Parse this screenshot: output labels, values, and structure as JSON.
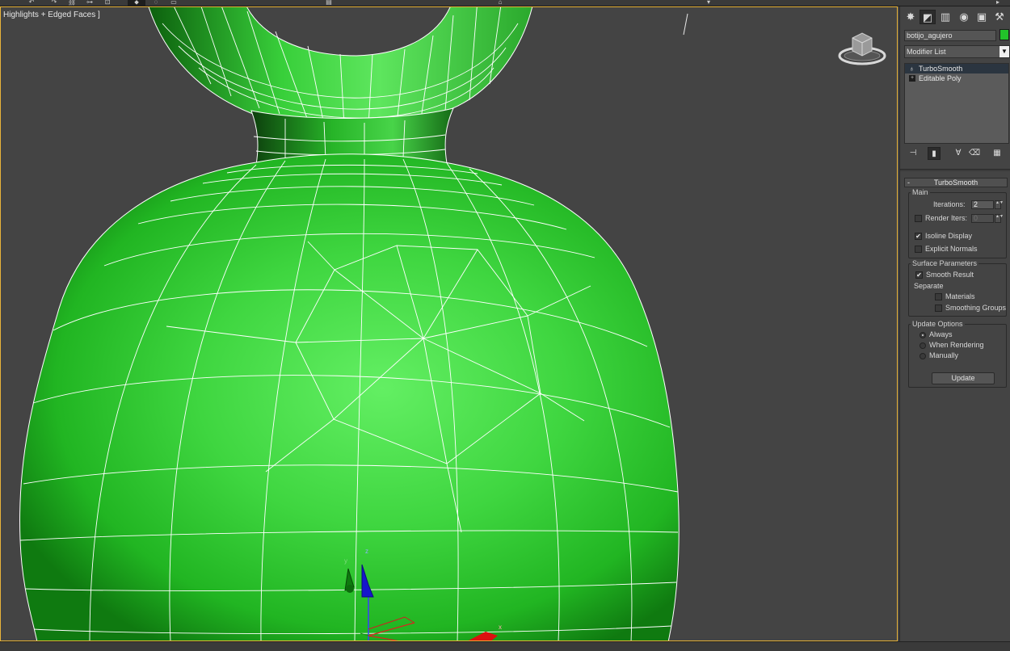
{
  "viewport": {
    "label": "Highlights + Edged Faces ]",
    "gizmo_axes": [
      "x",
      "y",
      "z"
    ],
    "mesh_color": "#2fd036",
    "wire_color": "#ffffff",
    "active_border": "#e8b33a",
    "viewcube_icon": "viewcube-icon"
  },
  "panel": {
    "tabs": [
      {
        "name": "create-tab",
        "glyph": "✸"
      },
      {
        "name": "modify-tab",
        "glyph": "◩"
      },
      {
        "name": "hierarchy-tab",
        "glyph": "▥"
      },
      {
        "name": "motion-tab",
        "glyph": "◉"
      },
      {
        "name": "display-tab",
        "glyph": "▣"
      },
      {
        "name": "utilities-tab",
        "glyph": "⚒"
      }
    ],
    "object_name": "botijo_agujero",
    "object_color": "#22c22a",
    "modifier_list": "Modifier List",
    "stack": [
      {
        "label": "TurboSmooth",
        "selected": true
      },
      {
        "label": "Editable Poly",
        "selected": false
      }
    ],
    "turbosmooth": {
      "title": "TurboSmooth",
      "main": {
        "title": "Main",
        "iterations_label": "Iterations:",
        "iterations": "2",
        "render_iters_label": "Render Iters:",
        "render_iters": "0",
        "render_iters_checked": false,
        "isoline_label": "Isoline Display",
        "isoline_checked": true,
        "explicit_normals_label": "Explicit Normals",
        "explicit_normals_checked": false
      },
      "surface": {
        "title": "Surface Parameters",
        "smooth_result_label": "Smooth Result",
        "smooth_result_checked": true,
        "separate_label": "Separate",
        "materials_label": "Materials",
        "materials_checked": false,
        "smoothing_groups_label": "Smoothing Groups",
        "smoothing_groups_checked": false
      },
      "update": {
        "title": "Update Options",
        "always_label": "Always",
        "when_rendering_label": "When Rendering",
        "manually_label": "Manually",
        "selected": "Always",
        "update_button": "Update"
      }
    }
  }
}
